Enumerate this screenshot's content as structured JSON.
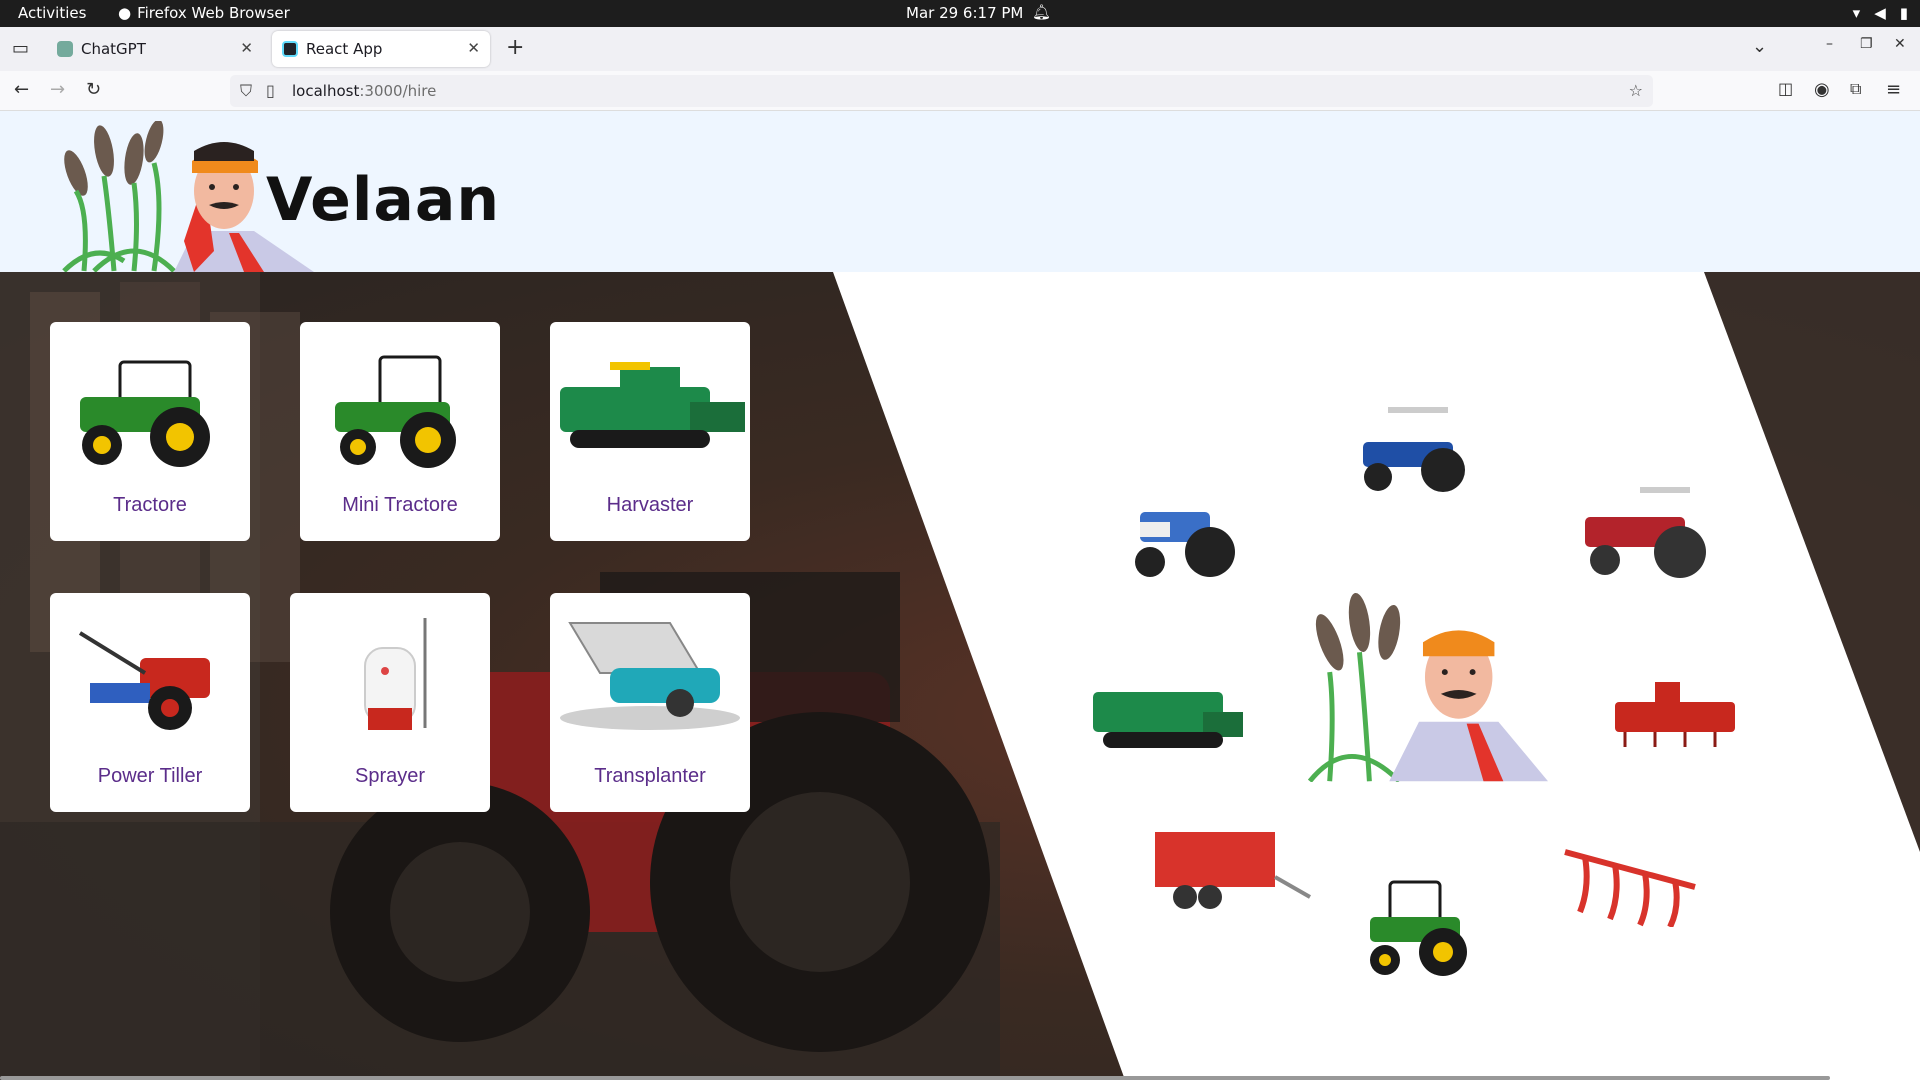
{
  "os": {
    "activities": "Activities",
    "app_name": "Firefox Web Browser",
    "clock": "Mar 29  6:17 PM"
  },
  "browser": {
    "tabs": [
      {
        "title": "ChatGPT",
        "active": false
      },
      {
        "title": "React App",
        "active": true
      }
    ],
    "url_host": "localhost",
    "url_path": ":3000/hire"
  },
  "site": {
    "title": "Velaan"
  },
  "categories": [
    {
      "label": "Tractore",
      "icon": "tractor-icon"
    },
    {
      "label": "Mini Tractore",
      "icon": "mini-tractor-icon"
    },
    {
      "label": "Harvaster",
      "icon": "harvester-icon"
    },
    {
      "label": "Power Tiller",
      "icon": "power-tiller-icon"
    },
    {
      "label": "Sprayer",
      "icon": "sprayer-icon"
    },
    {
      "label": "Transplanter",
      "icon": "transplanter-icon"
    }
  ],
  "colors": {
    "header_bg": "#eef6ff",
    "card_label": "#5b2d8a",
    "tractor_green": "#2a8a2a",
    "tractor_yellow": "#f2c400",
    "machine_red": "#c8281e"
  }
}
